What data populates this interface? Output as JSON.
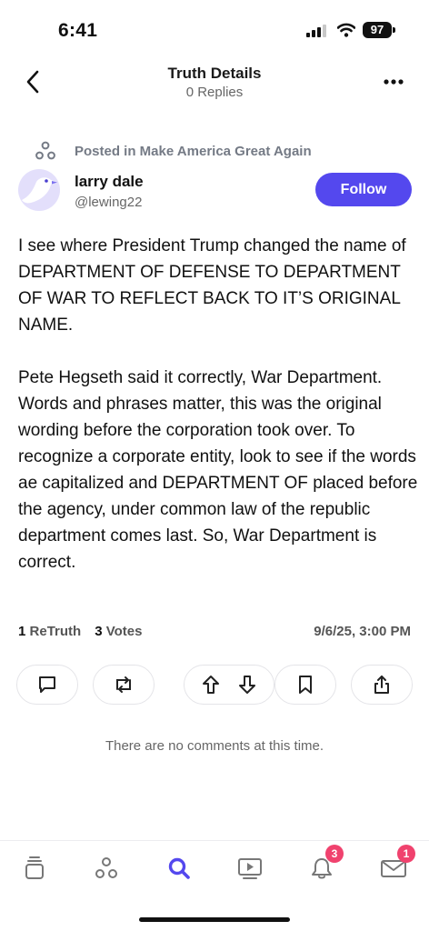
{
  "status_bar": {
    "time": "6:41",
    "battery": "97",
    "icons": [
      "signal-icon",
      "wifi-icon",
      "battery-icon"
    ]
  },
  "header": {
    "title": "Truth Details",
    "subtitle": "0 Replies",
    "back_icon": "chevron-left-icon",
    "more_icon": "ellipsis-icon"
  },
  "post": {
    "group_line": "Posted in Make America Great Again",
    "author": {
      "display_name": "larry dale",
      "handle": "@lewing22"
    },
    "follow_label": "Follow",
    "paragraphs": [
      "I see where President Trump changed the name of DEPARTMENT OF DEFENSE TO DEPARTMENT OF WAR TO REFLECT BACK TO IT’S ORIGINAL NAME.",
      "Pete Hegseth said it correctly, War Department. Words and phrases matter, this was the original wording before the corporation took over. To recognize a corporate entity, look to see if the words ae capitalized and DEPARTMENT OF placed before the agency, under common law of the republic department comes last. So, War Department is correct."
    ],
    "retruth_count": "1",
    "retruth_label": "ReTruth",
    "votes_count": "3",
    "votes_label": "Votes",
    "timestamp": "9/6/25, 3:00 PM",
    "actions": [
      "comment-icon",
      "retruth-icon",
      "upvote-icon",
      "downvote-icon",
      "bookmark-icon",
      "share-icon"
    ]
  },
  "comments": {
    "empty_text": "There are no comments at this time."
  },
  "tab_bar": {
    "tabs": [
      "feed-icon",
      "groups-icon",
      "search-icon",
      "video-icon",
      "notifications-icon",
      "messages-icon"
    ],
    "active_tab": "search-icon",
    "notifications_badge": "3",
    "messages_badge": "1"
  },
  "colors": {
    "accent": "#5448ee",
    "badge": "#f0426e",
    "muted": "#666666"
  }
}
